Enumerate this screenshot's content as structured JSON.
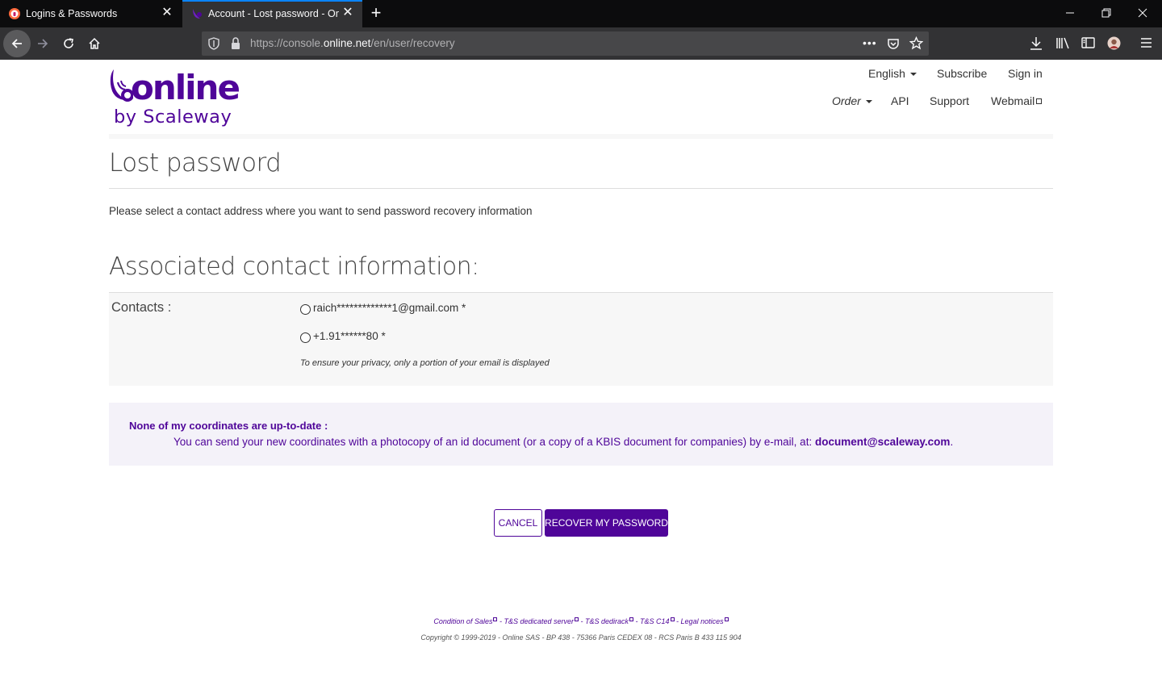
{
  "browser": {
    "tabs": [
      {
        "title": "Logins & Passwords",
        "active": false
      },
      {
        "title": "Account - Lost password - Online",
        "active": true
      }
    ],
    "url_prefix": "https://console.",
    "url_host": "online.net",
    "url_path": "/en/user/recovery",
    "accent_color": "#0a84ff"
  },
  "header": {
    "logo_word": "online",
    "logo_sub": "by Scaleway",
    "top_links": {
      "language": "English",
      "subscribe": "Subscribe",
      "signin": "Sign in"
    },
    "nav_links": {
      "order": "Order",
      "api": "API",
      "support": "Support",
      "webmail": "Webmail"
    }
  },
  "main": {
    "title": "Lost password",
    "intro": "Please select a contact address where you want to send password recovery information",
    "section_title": "Associated contact information:",
    "contacts_label": "Contacts :",
    "contacts": [
      {
        "value": "raich*************1@gmail.com *"
      },
      {
        "value": "+1.91******80 *"
      }
    ],
    "privacy_note": "To ensure your privacy, only a portion of your email is displayed",
    "notice_title": "None of my coordinates are up-to-date :",
    "notice_body": "You can send your new coordinates with a photocopy of an id document (or a copy of a KBIS document for companies) by e-mail, at: ",
    "notice_email": "document@scaleway.com",
    "notice_end": ".",
    "cancel_label": "CANCEL",
    "recover_label": "RECOVER MY PASSWORD",
    "brand_color": "#4f0599"
  },
  "footer": {
    "links": [
      "Condition of Sales",
      "T&S dedicated server",
      "T&S dedirack",
      "T&S C14",
      "Legal notices"
    ],
    "separator": " - ",
    "copyright": "Copyright © 1999-2019 - Online SAS - BP 438 - 75366 Paris CEDEX 08 - RCS Paris B 433 115 904"
  }
}
